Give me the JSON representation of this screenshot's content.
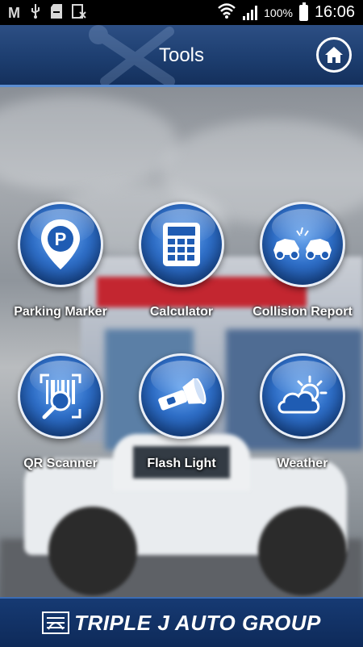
{
  "status_bar": {
    "battery_percent": "100%",
    "time": "16:06",
    "icons": [
      "gmail-icon",
      "usb-icon",
      "sd-card-icon",
      "sim-off-icon",
      "wifi-icon",
      "signal-icon",
      "battery-icon"
    ]
  },
  "header": {
    "title": "Tools",
    "home_icon": "home-icon"
  },
  "tools": [
    {
      "label": "Parking Marker",
      "icon": "parking-marker-icon"
    },
    {
      "label": "Calculator",
      "icon": "calculator-icon"
    },
    {
      "label": "Collision Report",
      "icon": "collision-icon"
    },
    {
      "label": "QR Scanner",
      "icon": "qr-scanner-icon"
    },
    {
      "label": "Flash Light",
      "icon": "flashlight-icon"
    },
    {
      "label": "Weather",
      "icon": "weather-icon"
    }
  ],
  "footer": {
    "brand": "TRIPLE J AUTO GROUP"
  },
  "colors": {
    "header_bg": "#1d3e70",
    "button_blue": "#2f6fc8",
    "footer_bg": "#163a73"
  }
}
